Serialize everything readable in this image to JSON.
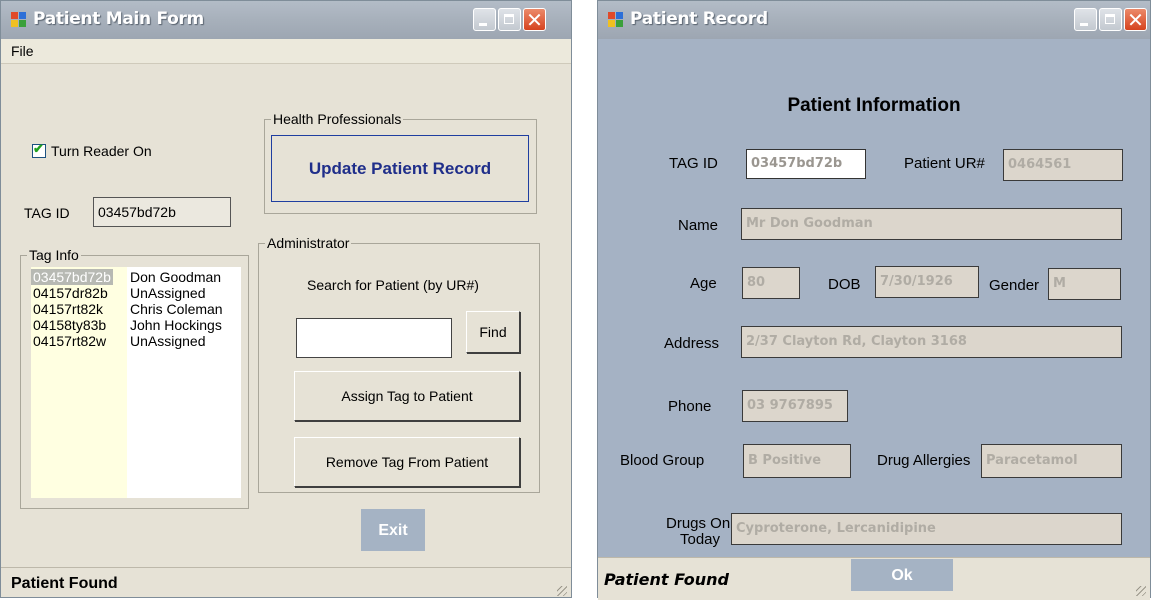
{
  "left": {
    "title": "Patient Main Form",
    "menu": {
      "file": "File"
    },
    "reader_checkbox": {
      "label": "Turn Reader On",
      "checked": true
    },
    "tag_id": {
      "label": "TAG ID",
      "value": "03457bd72b"
    },
    "tag_info": {
      "title": "Tag Info",
      "rows": [
        {
          "tag": "03457bd72b",
          "name": "Don Goodman",
          "selected": true
        },
        {
          "tag": "04157dr82b",
          "name": "UnAssigned"
        },
        {
          "tag": "04157rt82k",
          "name": "Chris Coleman"
        },
        {
          "tag": "04158ty83b",
          "name": "John Hockings"
        },
        {
          "tag": "04157rt82w",
          "name": "UnAssigned"
        }
      ]
    },
    "health_professionals": {
      "title": "Health Professionals",
      "update_button": "Update Patient Record"
    },
    "administrator": {
      "title": "Administrator",
      "search_label": "Search for Patient (by UR#)",
      "search_value": "",
      "find_button": "Find",
      "assign_button": "Assign Tag to Patient",
      "remove_button": "Remove Tag From Patient"
    },
    "exit_button": "Exit",
    "status": "Patient Found"
  },
  "right": {
    "title": "Patient Record",
    "heading": "Patient Information",
    "tag_id": {
      "label": "TAG ID",
      "value": "03457bd72b"
    },
    "patient_ur": {
      "label": "Patient UR#",
      "value": "0464561"
    },
    "name": {
      "label": "Name",
      "value": "Mr Don Goodman"
    },
    "age": {
      "label": "Age",
      "value": "80"
    },
    "dob": {
      "label": "DOB",
      "value": "7/30/1926"
    },
    "gender": {
      "label": "Gender",
      "value": "M"
    },
    "address": {
      "label": "Address",
      "value": "2/37 Clayton Rd, Clayton 3168"
    },
    "phone": {
      "label": "Phone",
      "value": "03 9767895"
    },
    "blood_group": {
      "label": "Blood Group",
      "value": "B Positive"
    },
    "drug_allergies": {
      "label": "Drug Allergies",
      "value": "Paracetamol"
    },
    "drugs_on_today": {
      "label_line1": "Drugs On",
      "label_line2": "Today",
      "value": "Cyproterone, Lercanidipine"
    },
    "ok_button": "Ok",
    "status": "Patient Found"
  },
  "colors": {
    "form_background": "#e6e2d6",
    "record_background": "#a5b2c4",
    "title_bar": "#a7b0bb",
    "close_button": "#d6431f",
    "update_button_text": "#1f2e8a"
  }
}
